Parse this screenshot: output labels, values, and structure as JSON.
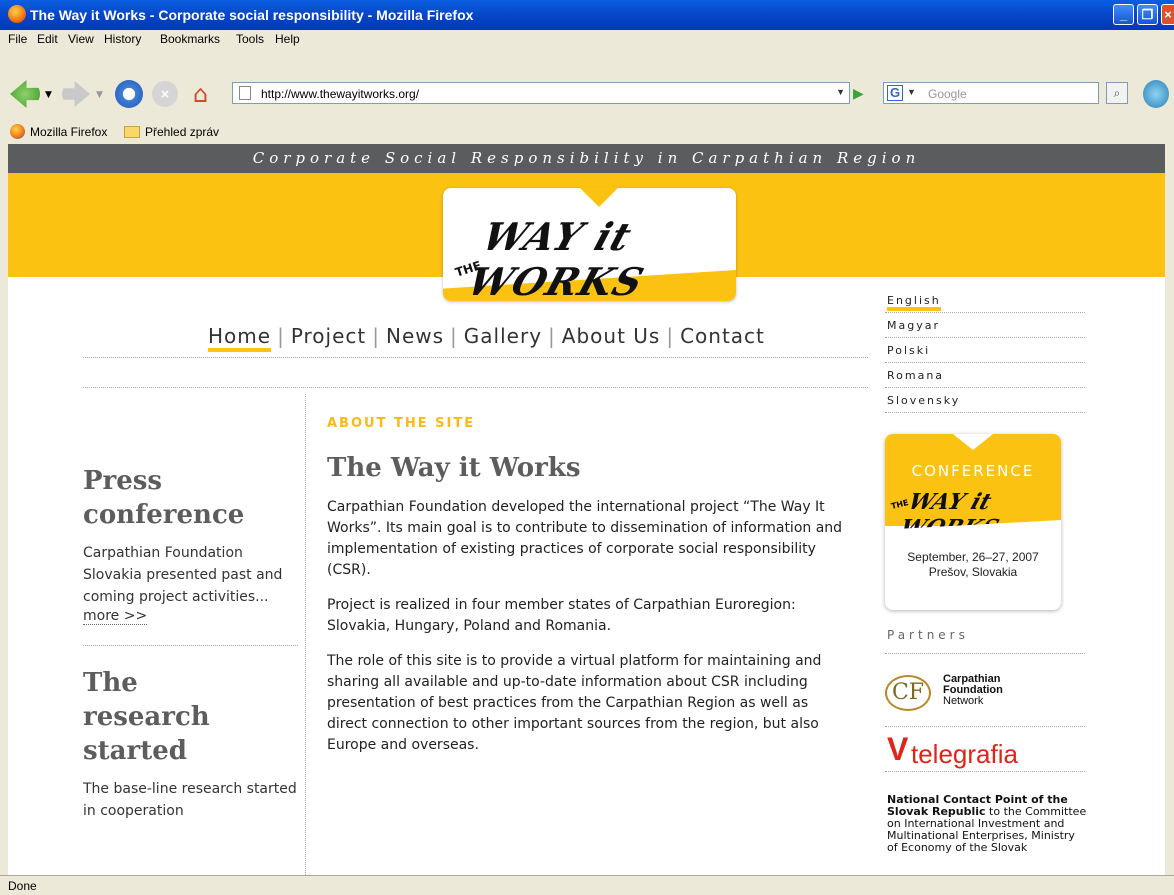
{
  "window": {
    "title": "The Way it Works - Corporate social responsibility - Mozilla Firefox"
  },
  "menu": [
    "File",
    "Edit",
    "View",
    "History",
    "Bookmarks",
    "Tools",
    "Help"
  ],
  "toolbar": {
    "url": "http://www.thewayitworks.org/",
    "search_placeholder": "Google"
  },
  "bookmarks": [
    "Mozilla Firefox",
    "Přehled zpráv"
  ],
  "site": {
    "tagline": "Corporate Social Responsibility in Carpathian Region",
    "logo_text": "WAY it WORKS",
    "logo_the": "THE",
    "nav": [
      "Home",
      "Project",
      "News",
      "Gallery",
      "About Us",
      "Contact"
    ],
    "nav_active": "Home",
    "languages": [
      "English",
      "Magyar",
      "Polski",
      "Romana",
      "Slovensky"
    ],
    "language_active": "English"
  },
  "left": {
    "story1": {
      "title": "Press conference",
      "body": "Carpathian Foundation Slovakia presented past and coming project activities...",
      "more": "more >>"
    },
    "story2": {
      "title": "The research started",
      "body": "The base-line research started in cooperation"
    }
  },
  "main": {
    "kicker": "ABOUT THE SITE",
    "title": "The Way it Works",
    "paragraphs": [
      "Carpathian Foundation developed the international project “The Way It Works”. Its main goal is to contribute to dissemination of information and implementation of existing practices of corporate social responsibility (CSR).",
      "Project is realized in four member states of Carpathian Euroregion: Slovakia, Hungary, Poland and Romania.",
      "The role of this site is to provide a virtual platform for maintaining and sharing all available and up-to-date information about CSR including presentation of best practices from the Carpathian Region as well as direct connection to other important sources from the region, but also Europe and overseas."
    ]
  },
  "sidebar": {
    "conference": {
      "heading": "CONFERENCE",
      "script": "WAY it WORKS",
      "the": "THE",
      "date": "September, 26–27, 2007",
      "place": "Prešov, Slovakia"
    },
    "partners_label": "Partners",
    "cf": {
      "initials": "CF",
      "line1": "Carpathian",
      "line2": "Foundation",
      "line3": "Network"
    },
    "telegrafia": {
      "v": "V",
      "name": "telegrafia"
    },
    "ncp": {
      "bold": "National Contact Point of the Slovak Republic",
      "rest": " to the Committee on International Investment and Multinational Enterprises, Ministry of Economy of the Slovak"
    }
  },
  "status": "Done"
}
